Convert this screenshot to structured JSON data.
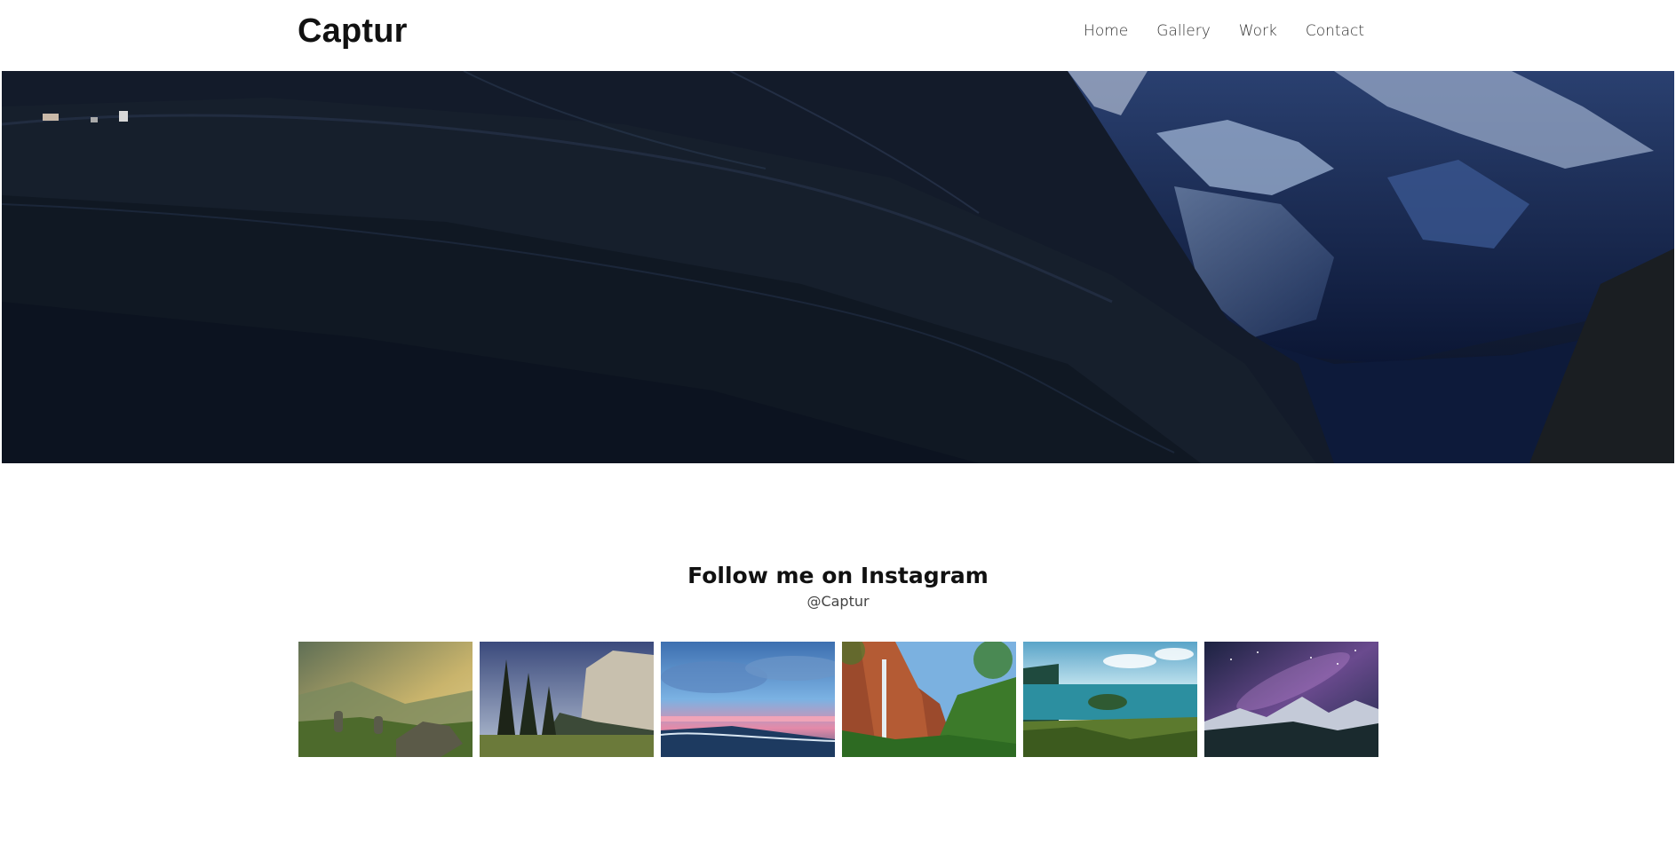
{
  "brand": {
    "name": "Captur"
  },
  "nav": {
    "items": [
      {
        "label": "Home"
      },
      {
        "label": "Gallery"
      },
      {
        "label": "Work"
      },
      {
        "label": "Contact"
      }
    ]
  },
  "hero": {
    "image": "mountain-valley-dusk-photo"
  },
  "instagram": {
    "title": "Follow me on Instagram",
    "handle": "@Captur",
    "thumbnails": [
      {
        "image": "misty-hills-sunlight-photo"
      },
      {
        "image": "forest-cliff-valley-photo"
      },
      {
        "image": "beach-sunset-photo"
      },
      {
        "image": "canyon-waterfall-photo"
      },
      {
        "image": "lake-island-photo"
      },
      {
        "image": "milky-way-mountains-photo"
      }
    ]
  }
}
